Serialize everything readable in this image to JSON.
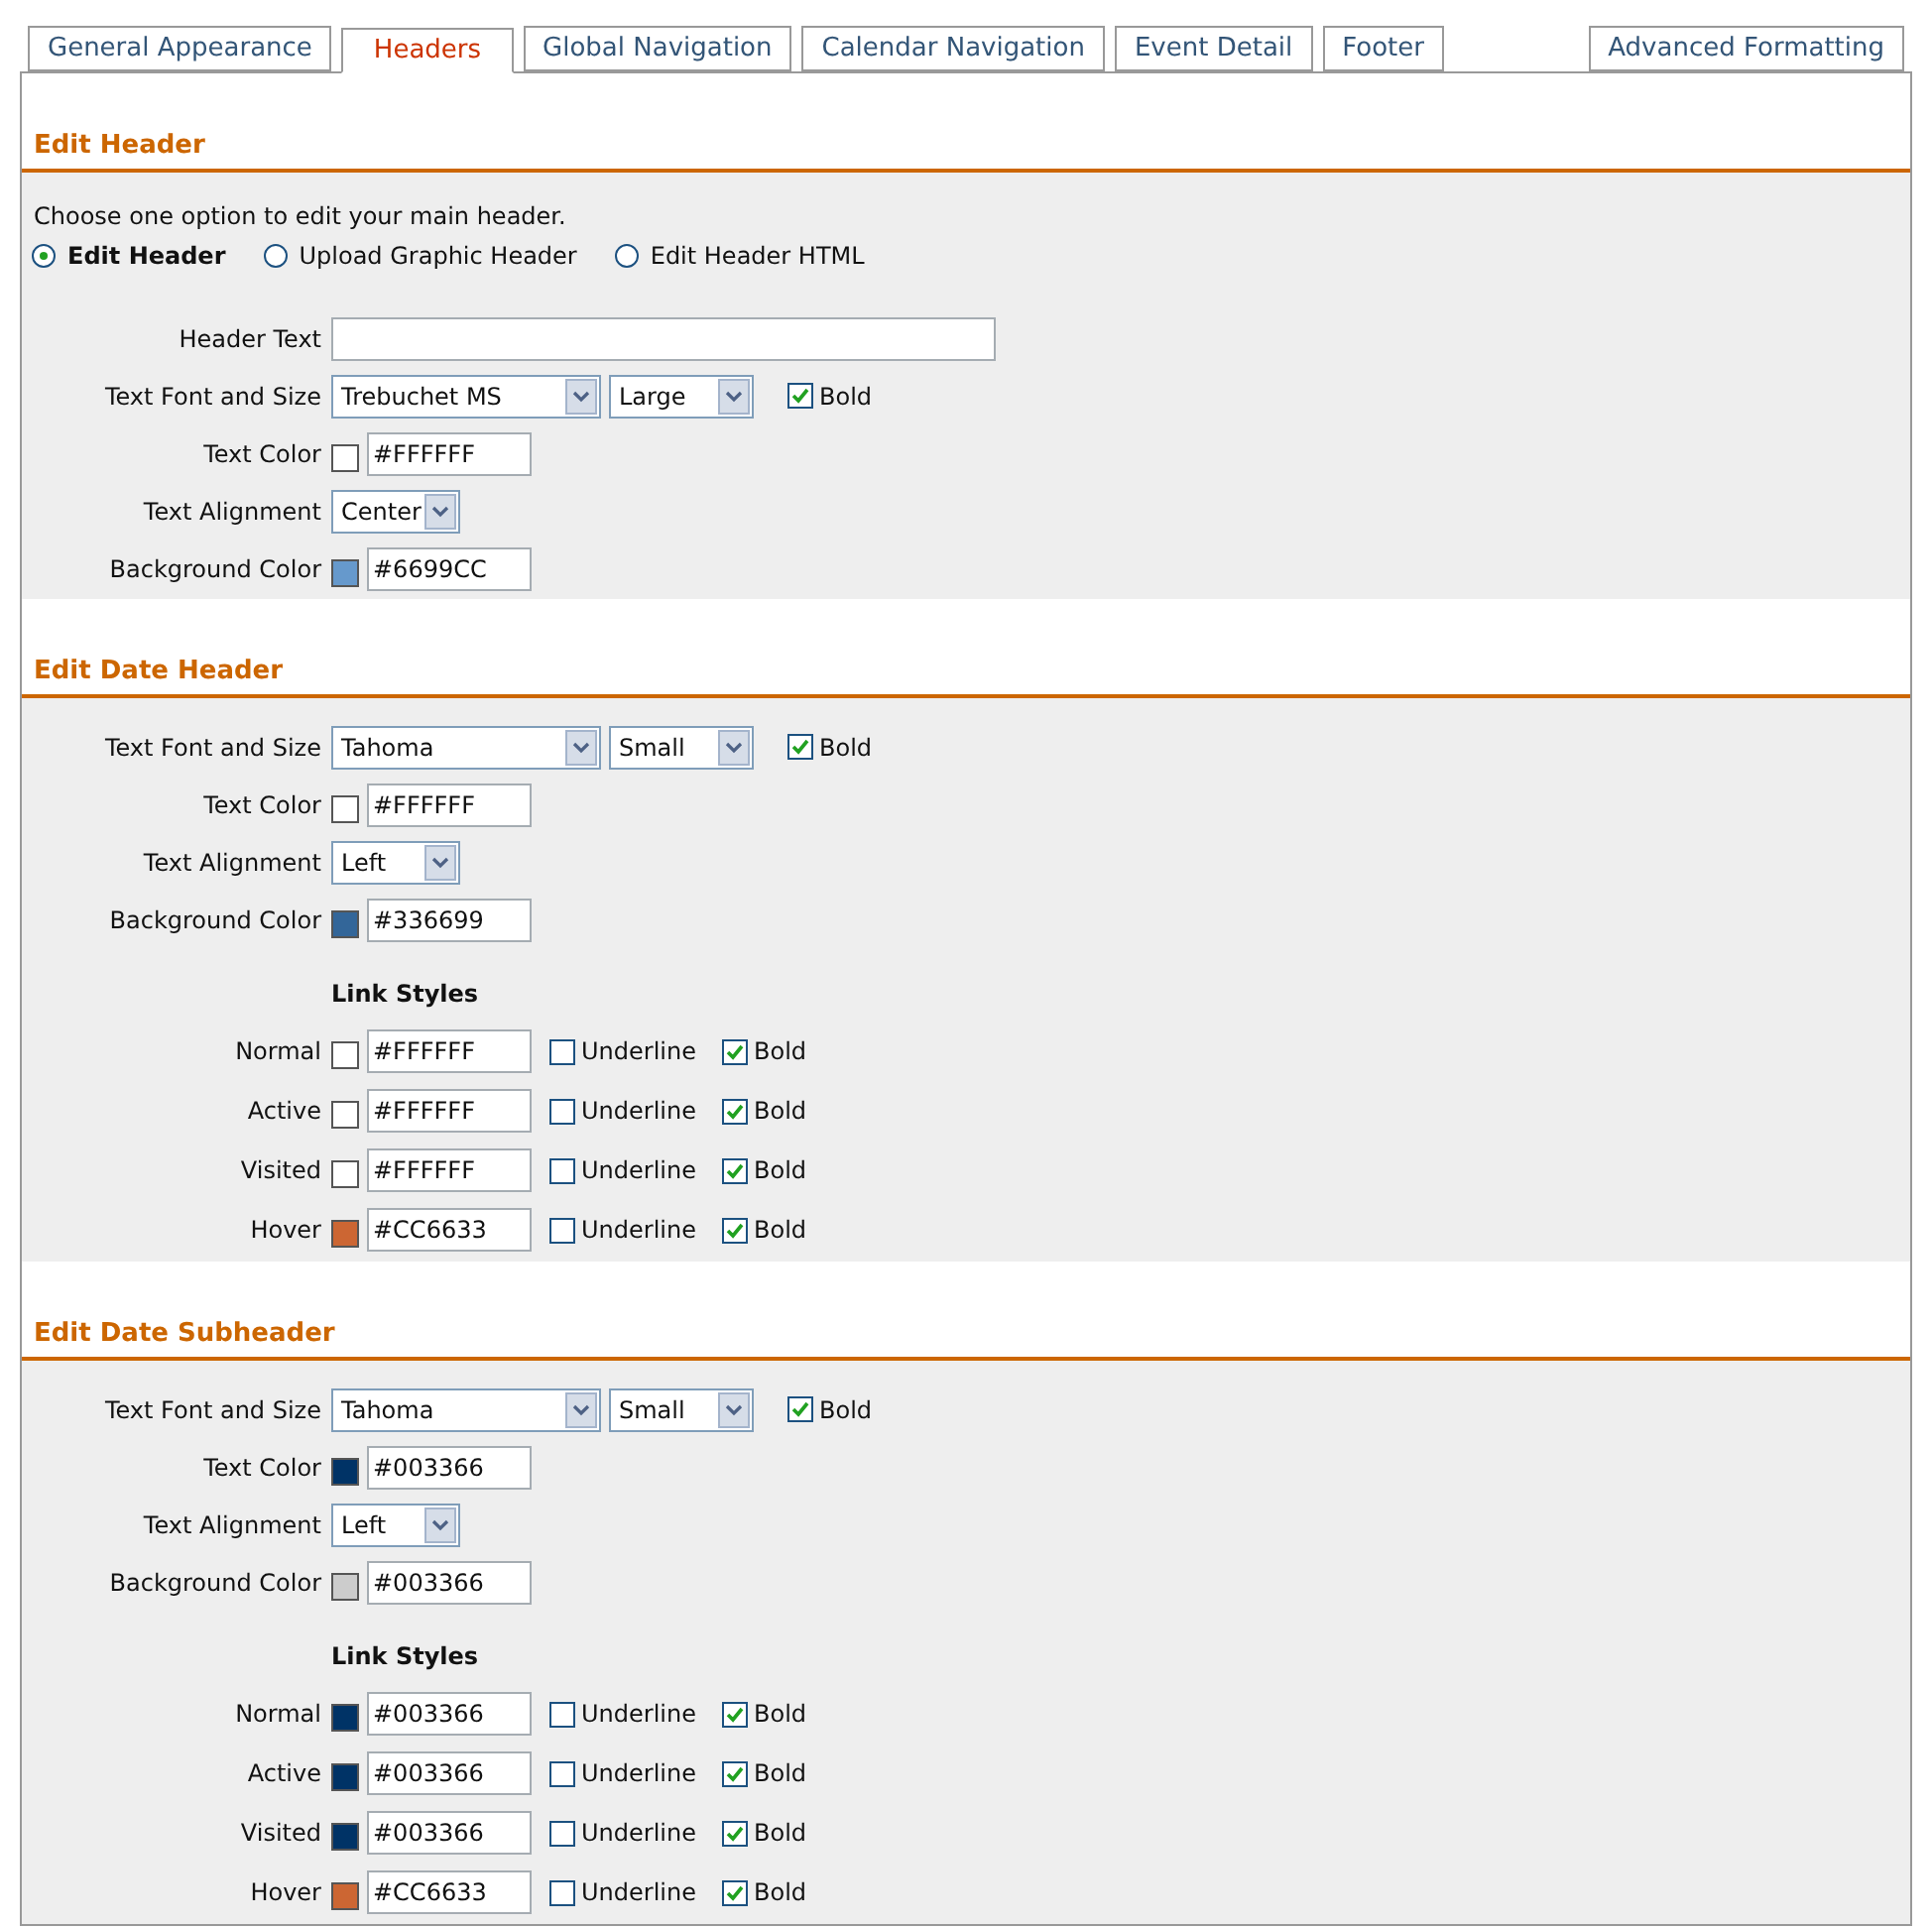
{
  "tabs": [
    {
      "label": "General Appearance",
      "selected": false
    },
    {
      "label": "Headers",
      "selected": true
    },
    {
      "label": "Global Navigation",
      "selected": false
    },
    {
      "label": "Calendar Navigation",
      "selected": false
    },
    {
      "label": "Event Detail",
      "selected": false
    },
    {
      "label": "Footer",
      "selected": false
    },
    {
      "label": "Advanced Formatting",
      "selected": false
    }
  ],
  "sections": [
    {
      "title": "Edit Header",
      "intro": "Choose one option to edit your main header.",
      "options": [
        {
          "label": "Edit Header",
          "selected": true
        },
        {
          "label": "Upload Graphic Header",
          "selected": false
        },
        {
          "label": "Edit Header HTML",
          "selected": false
        }
      ],
      "rows": [
        {
          "kind": "text",
          "label": "Header Text"
        },
        {
          "kind": "font",
          "label": "Text Font and Size",
          "font": "Trebuchet MS",
          "size": "Large",
          "bold": {
            "label": "Bold",
            "checked": true
          }
        },
        {
          "kind": "color",
          "label": "Text Color",
          "color": "#ffffff",
          "value": "#FFFFFF"
        },
        {
          "kind": "align",
          "label": "Text Alignment",
          "value": "Center"
        },
        {
          "kind": "color",
          "label": "Background Color",
          "color": "#6699cc",
          "value": "#6699CC"
        }
      ]
    },
    {
      "title": "Edit Date Header",
      "rows": [
        {
          "kind": "font",
          "label": "Text Font and Size",
          "font": "Tahoma",
          "size": "Small",
          "bold": {
            "label": "Bold",
            "checked": true
          }
        },
        {
          "kind": "color",
          "label": "Text Color",
          "color": "#ffffff",
          "value": "#FFFFFF"
        },
        {
          "kind": "align",
          "label": "Text Alignment",
          "value": "Left"
        },
        {
          "kind": "color",
          "label": "Background Color",
          "color": "#336699",
          "value": "#336699"
        }
      ],
      "link_styles": {
        "title": "Link Styles",
        "rows": [
          {
            "label": "Normal",
            "color": "#ffffff",
            "value": "#FFFFFF",
            "underline": {
              "label": "Underline",
              "checked": false
            },
            "bold": {
              "label": "Bold",
              "checked": true
            }
          },
          {
            "label": "Active",
            "color": "#ffffff",
            "value": "#FFFFFF",
            "underline": {
              "label": "Underline",
              "checked": false
            },
            "bold": {
              "label": "Bold",
              "checked": true
            }
          },
          {
            "label": "Visited",
            "color": "#ffffff",
            "value": "#FFFFFF",
            "underline": {
              "label": "Underline",
              "checked": false
            },
            "bold": {
              "label": "Bold",
              "checked": true
            }
          },
          {
            "label": "Hover",
            "color": "#cc6633",
            "value": "#CC6633",
            "underline": {
              "label": "Underline",
              "checked": false
            },
            "bold": {
              "label": "Bold",
              "checked": true
            }
          }
        ]
      }
    },
    {
      "title": "Edit Date Subheader",
      "rows": [
        {
          "kind": "font",
          "label": "Text Font and Size",
          "font": "Tahoma",
          "size": "Small",
          "bold": {
            "label": "Bold",
            "checked": true
          }
        },
        {
          "kind": "color",
          "label": "Text Color",
          "color": "#003366",
          "value": "#003366"
        },
        {
          "kind": "align",
          "label": "Text Alignment",
          "value": "Left"
        },
        {
          "kind": "color",
          "label": "Background Color",
          "color": "#cccccc",
          "value": "#003366"
        }
      ],
      "link_styles": {
        "title": "Link Styles",
        "rows": [
          {
            "label": "Normal",
            "color": "#003366",
            "value": "#003366",
            "underline": {
              "label": "Underline",
              "checked": false
            },
            "bold": {
              "label": "Bold",
              "checked": true
            }
          },
          {
            "label": "Active",
            "color": "#003366",
            "value": "#003366",
            "underline": {
              "label": "Underline",
              "checked": false
            },
            "bold": {
              "label": "Bold",
              "checked": true
            }
          },
          {
            "label": "Visited",
            "color": "#003366",
            "value": "#003366",
            "underline": {
              "label": "Underline",
              "checked": false
            },
            "bold": {
              "label": "Bold",
              "checked": true
            }
          },
          {
            "label": "Hover",
            "color": "#cc6633",
            "value": "#CC6633",
            "underline": {
              "label": "Underline",
              "checked": false
            },
            "bold": {
              "label": "Bold",
              "checked": true
            }
          }
        ]
      }
    }
  ]
}
